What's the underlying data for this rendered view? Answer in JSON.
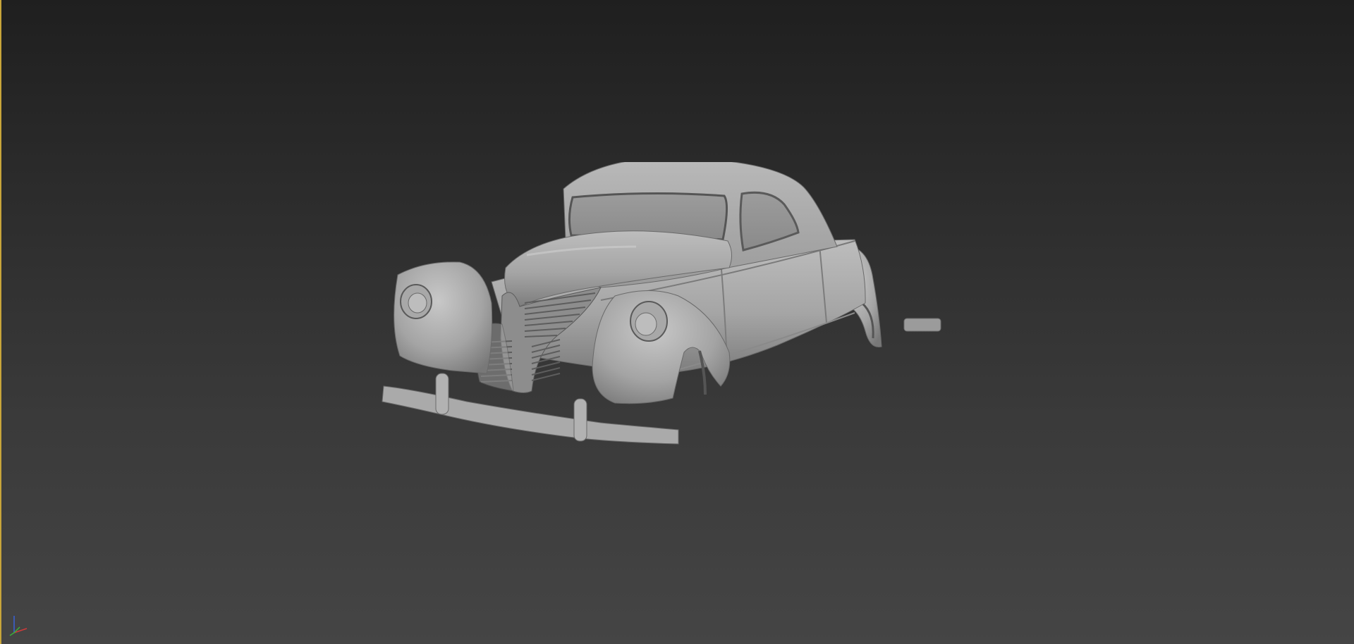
{
  "viewport": {
    "background_top": "#1f1f1f",
    "background_bottom": "#454545",
    "active_border_color": "#c8a53a"
  },
  "scene": {
    "model_icon": "car-body-3d-model",
    "shading_color": "#a9a9a9"
  },
  "axis_gizmo": {
    "icon": "xyz-axis-tripod-icon",
    "x_color": "#d03a3a",
    "y_color": "#3ab03a",
    "z_color": "#3a62d8"
  }
}
